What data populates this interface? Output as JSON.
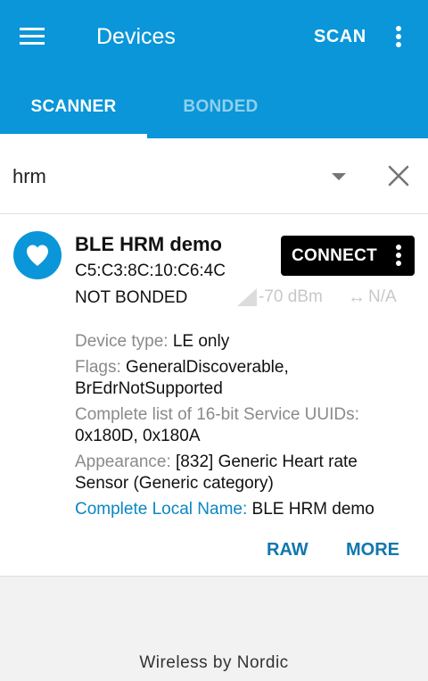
{
  "app_bar": {
    "menu_icon": "hamburger-menu-icon",
    "title": "Devices",
    "scan_label": "SCAN",
    "overflow_icon": "more-vertical-icon"
  },
  "tabs": [
    {
      "label": "SCANNER",
      "selected": true
    },
    {
      "label": "BONDED",
      "selected": false
    }
  ],
  "filter": {
    "value": "hrm",
    "dropdown_icon": "arrow-drop-down-icon",
    "clear_icon": "close-icon"
  },
  "device": {
    "icon": "heart-icon",
    "name": "BLE HRM demo",
    "address": "C5:C3:8C:10:C6:4C",
    "bond_state": "NOT BONDED",
    "rssi": "-70 dBm",
    "interval": "N/A",
    "connect_label": "CONNECT",
    "details": [
      {
        "key": "Device type: ",
        "value": "LE only"
      },
      {
        "key": "Flags: ",
        "value": "GeneralDiscoverable, BrEdrNotSupported"
      },
      {
        "key": "Complete list of 16-bit Service UUIDs: ",
        "value": "0x180D, 0x180A"
      },
      {
        "key": "Appearance: ",
        "value": "[832] Generic Heart rate Sensor (Generic category)"
      },
      {
        "key": "Complete Local Name: ",
        "value": "BLE HRM demo"
      }
    ],
    "raw_label": "RAW",
    "more_label": "MORE"
  },
  "footer": "Wireless by Nordic",
  "colors": {
    "primary": "#0a96d8",
    "action_text": "#1177ae",
    "local_name_key": "#0a86c4"
  }
}
